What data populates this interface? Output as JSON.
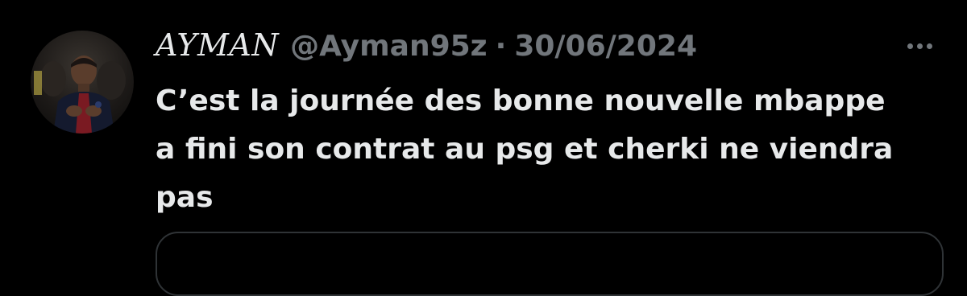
{
  "tweet": {
    "author": {
      "display_name": "AYMAN",
      "handle": "@Ayman95z"
    },
    "separator": "·",
    "date": "30/06/2024",
    "text_lines": [
      "C’est la journée des bonne nouvelle mbappe",
      "a fini son contrat au psg et cherki ne viendra",
      "pas"
    ]
  },
  "icons": {
    "more": "more-horizontal-icon",
    "avatar": "profile-photo"
  },
  "colors": {
    "background": "#000000",
    "primary_text": "#e7e9ea",
    "secondary_text": "#71767b",
    "border": "#2f3336"
  }
}
